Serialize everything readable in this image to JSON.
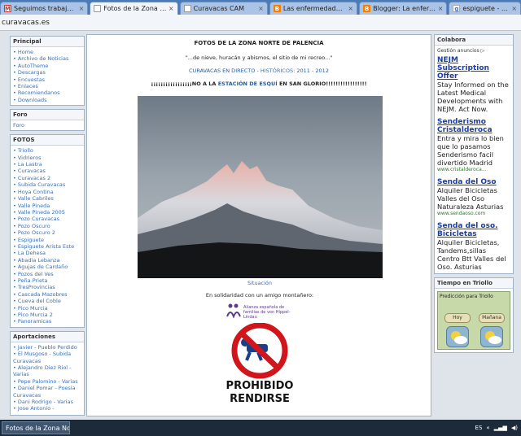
{
  "browser": {
    "tabs": [
      {
        "title": "Seguimos trabajand",
        "icon": "gmail-icon",
        "active": false
      },
      {
        "title": "Fotos de la Zona No",
        "icon": "page-icon",
        "active": true
      },
      {
        "title": "Curavacas CAM",
        "icon": "page-icon",
        "active": false
      },
      {
        "title": "Las enfermedades ra",
        "icon": "blogger-icon",
        "active": false
      },
      {
        "title": "Blogger: La enferme",
        "icon": "blogger-icon",
        "active": false
      },
      {
        "title": "espiguete - Google",
        "icon": "google-icon",
        "active": false
      }
    ],
    "url": "curavacas.es"
  },
  "left_sidebar": {
    "principal": {
      "heading": "Principal",
      "items": [
        "Home",
        "Archivo de Noticias",
        "AutoTheme",
        "Descargas",
        "Encuestas",
        "Enlaces",
        "Recomiendanos",
        "Downloads"
      ]
    },
    "foro": {
      "heading": "Foro",
      "link": "Foro"
    },
    "fotos": {
      "heading": "FOTOS",
      "items": [
        "Triollo",
        "Vidrieros",
        "La Lastra",
        "Curavacas",
        "Curavacas 2",
        "Subida Curavacas",
        "Hoya Contina",
        "Valle Cabriles",
        "Valle Pineda",
        "Valle Pineda 2005",
        "Pozo Curavacas",
        "Pozo Oscuro",
        "Pozo Oscuro 2",
        "Espiguete",
        "Espiguete Arista Este",
        "La Dehesa",
        "Abadia Lebanza",
        "Agujas de Cardaño",
        "Pozos del Ves",
        "Peña Prieta",
        "TresProvincias",
        "Cascada Mazobres",
        "Cueva del Coble",
        "Pico Murcia",
        "Pico Murcia 2",
        "Panoramicas"
      ]
    },
    "aportaciones": {
      "heading": "Aportaciones",
      "items": [
        "Javier - Pueblo Perdido",
        "El Musgoso - Subida Curavacas",
        "Alejandro Diez Riol - Varias",
        "Pepe Palomino - Varias",
        "Daniel Pomar - Poesia Curavacas",
        "Dani Rodrigo - Varias",
        "Jose Antonio -"
      ]
    }
  },
  "main": {
    "title": "FOTOS DE LA ZONA NORTE DE PALENCIA",
    "quote": "\"...de nieve, huracán y abismos, el sitio de mi recreo...\"",
    "live_label": "CURAVACAS EN DIRECTO",
    "historic_label": "HISTÓRICOS:",
    "year1": "2011",
    "year2": "2012",
    "protest_pre": "¡¡¡¡¡¡¡¡¡¡¡¡¡¡¡¡¡NO A LA",
    "protest_hl": "ESTACIÓN DE ESQUÍ",
    "protest_post": "EN SAN GLORIO!!!!!!!!!!!!!!!!!",
    "caption": "Situación",
    "solidarity": "En solidaridad con un amigo montañero:",
    "alliance_text": "Alianza española de familias de von Hippel-Lindau",
    "prohibido_line1": "PROHIBIDO",
    "prohibido_line2": "RENDIRSE"
  },
  "right_sidebar": {
    "heading": "Colabora",
    "ads_label": "Gestión anuncios",
    "ads": [
      {
        "headline": "NEJM Subscription Offer",
        "body": "Stay Informed on the Latest Medical Developments with NEJM. Act Now.",
        "url": ""
      },
      {
        "headline": "Senderismo Cristalderoca",
        "body": "Entra y mira lo bien que lo pasamos Senderismo facil divertido Madrid",
        "url": "www.cristalderoca..."
      },
      {
        "headline": "Senda del Oso",
        "body": "Alquiler Bicicletas Valles del Oso Naturaleza Asturias",
        "url": "www.sendaoso.com"
      },
      {
        "headline": "Senda del oso. Bicicletas",
        "body": "Alquiler Bicicletas, Tandems,sillas Centro Btt Valles del Oso. Asturias",
        "url": ""
      }
    ],
    "weather": {
      "heading": "Tiempo en Triollo",
      "panel_title": "Predicción para Triollo",
      "today": "Hoy",
      "tomorrow": "Mañana"
    }
  },
  "taskbar": {
    "task": "Fotos de la Zona No...",
    "lang": "ES"
  }
}
